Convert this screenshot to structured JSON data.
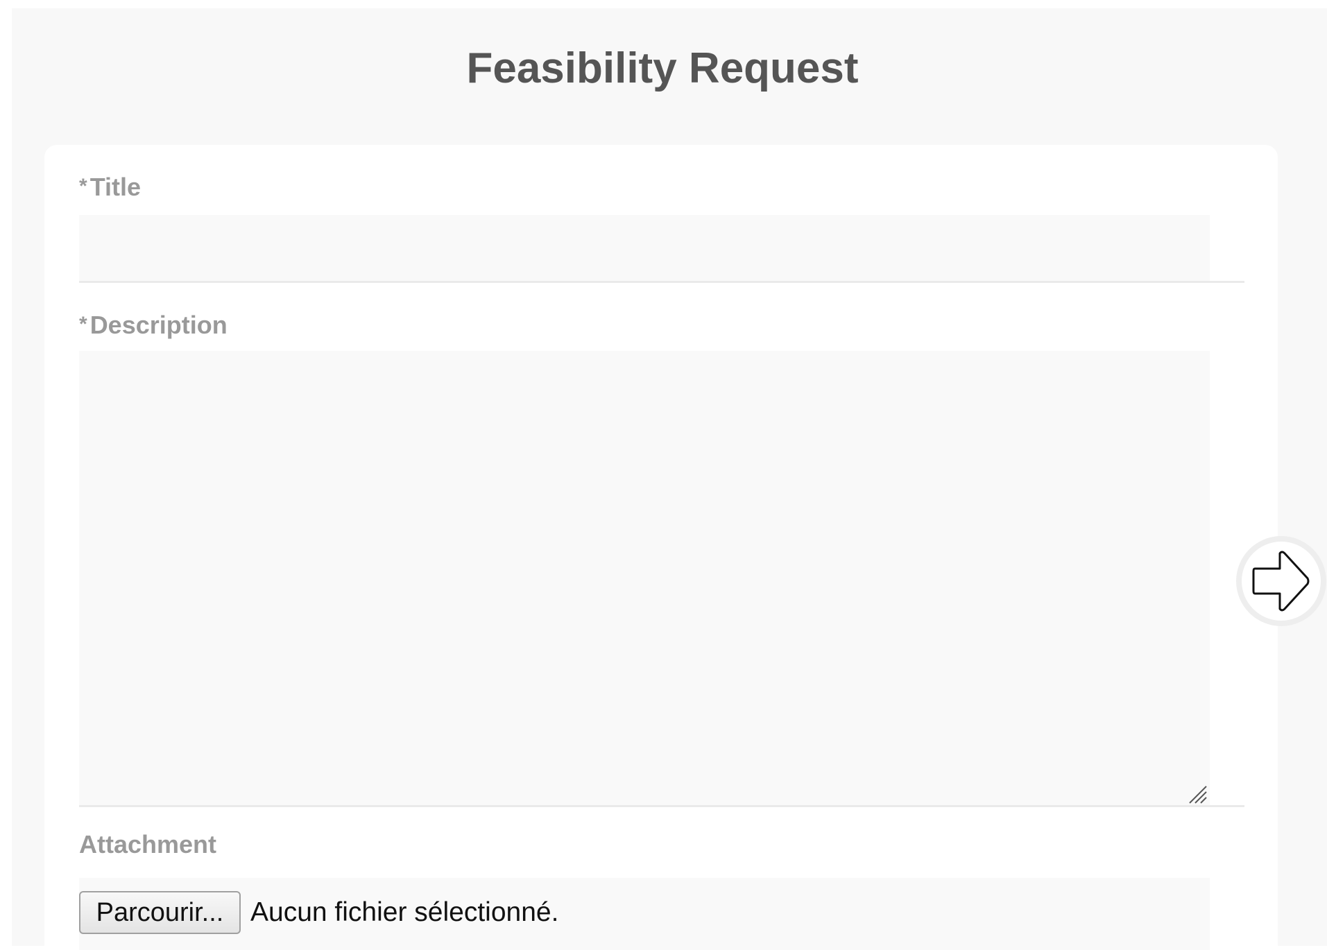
{
  "page": {
    "title": "Feasibility Request"
  },
  "form": {
    "title_field": {
      "required_marker": "*",
      "label": "Title",
      "value": "",
      "placeholder": ""
    },
    "description_field": {
      "required_marker": "*",
      "label": "Description",
      "value": "",
      "placeholder": ""
    },
    "attachment_field": {
      "label": "Attachment",
      "browse_label": "Parcourir...",
      "status": "Aucun fichier sélectionné."
    }
  },
  "navigation": {
    "next_icon": "arrow-right-icon"
  },
  "colors": {
    "page_background": "#f8f8f8",
    "card_background": "#ffffff",
    "input_background": "#f9f9f9",
    "label_text": "#999999",
    "title_text": "#555555"
  }
}
